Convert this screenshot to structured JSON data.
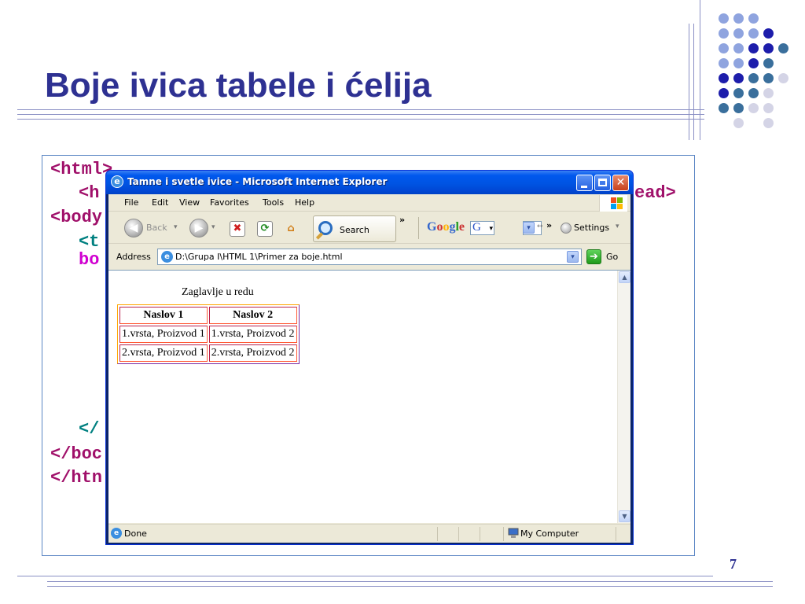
{
  "slide": {
    "title": "Boje ivica tabele i ćelija",
    "page_number": "7"
  },
  "code": {
    "lines": [
      "<html>",
      "<h",
      "ead>",
      "<body",
      "<t",
      "bo",
      "</",
      "</boc",
      "</htn"
    ]
  },
  "browser": {
    "window_title": "Tamne i svetle ivice - Microsoft Internet Explorer",
    "menu": [
      "File",
      "Edit",
      "View",
      "Favorites",
      "Tools",
      "Help"
    ],
    "toolbar": {
      "back_label": "Back",
      "search_label": "Search",
      "more_chevron": "»",
      "google_label": "Google",
      "google_combo_value": "G",
      "settings_label": "Settings"
    },
    "address": {
      "label": "Address",
      "value": "D:\\Grupa I\\HTML 1\\Primer za boje.html",
      "go_label": "Go"
    },
    "page": {
      "caption": "Zaglavlje u redu",
      "headers": [
        "Naslov 1",
        "Naslov 2"
      ],
      "rows": [
        [
          "1.vrsta, Proizvod 1",
          "1.vrsta, Proizvod 2"
        ],
        [
          "2.vrsta, Proizvod 1",
          "2.vrsta, Proizvod 2"
        ]
      ]
    },
    "status": {
      "text": "Done",
      "zone": "My Computer"
    }
  },
  "colors": {
    "title": "#2e3192",
    "table_border_light": "#ffa500",
    "table_border_dark": "#7a2aa0",
    "cell_border_dark": "#b8204e",
    "cell_border_light": "#ff5a36"
  }
}
